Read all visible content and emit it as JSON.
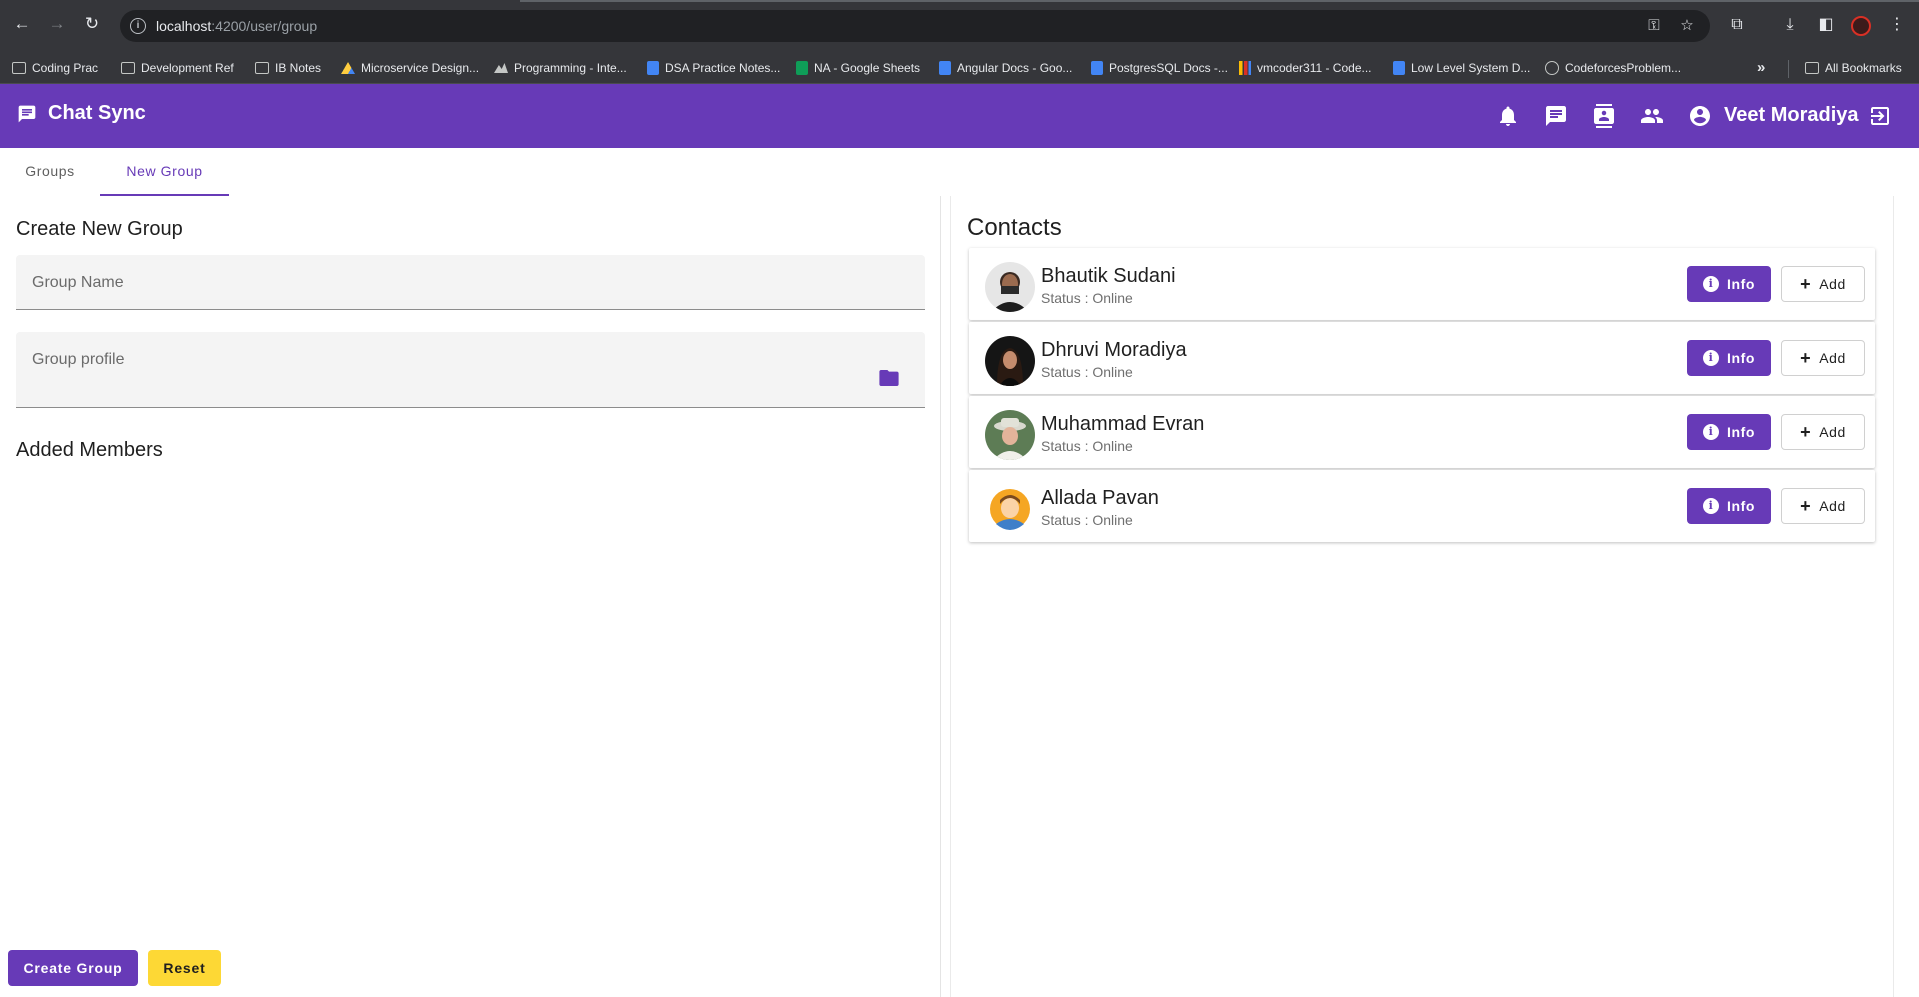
{
  "browser": {
    "url_host": "localhost",
    "url_rest": ":4200/user/group",
    "bookmarks": [
      {
        "label": "Coding Prac",
        "icon": "folder-icon"
      },
      {
        "label": "Development Ref",
        "icon": "folder-icon"
      },
      {
        "label": "IB Notes",
        "icon": "folder-icon"
      },
      {
        "label": "Microservice Design...",
        "icon": "drive-icon"
      },
      {
        "label": "Programming - Inte...",
        "icon": "mountain-icon"
      },
      {
        "label": "DSA Practice Notes...",
        "icon": "docs-icon"
      },
      {
        "label": "NA - Google Sheets",
        "icon": "sheets-icon"
      },
      {
        "label": "Angular Docs - Goo...",
        "icon": "docs-icon"
      },
      {
        "label": "PostgresSQL Docs -...",
        "icon": "docs-icon"
      },
      {
        "label": "vmcoder311 - Code...",
        "icon": "bars-icon"
      },
      {
        "label": "Low Level System D...",
        "icon": "docs-icon"
      },
      {
        "label": "CodeforcesProblem...",
        "icon": "globe-icon"
      }
    ],
    "all_bookmarks": "All Bookmarks",
    "more_glyph": "»"
  },
  "app": {
    "title": "Chat Sync",
    "user_name": "Veet Moradiya",
    "accent_color": "#673ab7",
    "warn_color": "#fdd835"
  },
  "tabs": [
    {
      "label": "Groups",
      "active": false
    },
    {
      "label": "New Group",
      "active": true
    }
  ],
  "form": {
    "heading": "Create New Group",
    "group_name_label": "Group Name",
    "group_profile_label": "Group profile",
    "added_members_heading": "Added Members",
    "create_button": "Create Group",
    "reset_button": "Reset"
  },
  "contacts": {
    "heading": "Contacts",
    "info_label": "Info",
    "add_label": "Add",
    "items": [
      {
        "name": "Bhautik Sudani",
        "status": "Status : Online"
      },
      {
        "name": "Dhruvi Moradiya",
        "status": "Status : Online"
      },
      {
        "name": "Muhammad Evran",
        "status": "Status : Online"
      },
      {
        "name": "Allada Pavan",
        "status": "Status : Online"
      }
    ]
  }
}
